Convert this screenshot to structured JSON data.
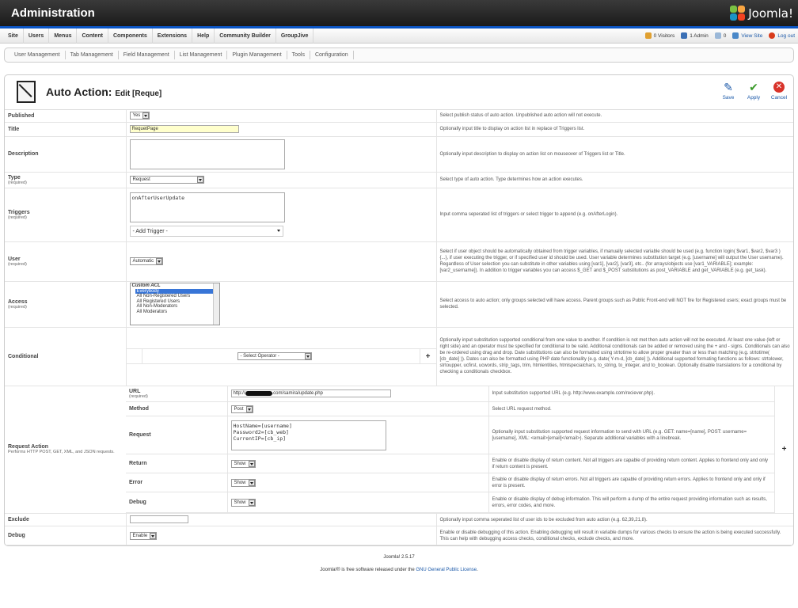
{
  "header": {
    "title": "Administration",
    "logo_text": "Joomla!"
  },
  "menubar": {
    "items": [
      "Site",
      "Users",
      "Menus",
      "Content",
      "Components",
      "Extensions",
      "Help",
      "Community Builder",
      "GroupJive"
    ],
    "visitors": "0 Visitors",
    "admins": "1 Admin",
    "messages": "0",
    "view_site": "View Site",
    "logout": "Log out"
  },
  "submenu": [
    "User Management",
    "Tab Management",
    "Field Management",
    "List Management",
    "Plugin Management",
    "Tools",
    "Configuration"
  ],
  "toolbar": {
    "title": "Auto Action:",
    "subtitle": "Edit [Reque]",
    "save": "Save",
    "apply": "Apply",
    "cancel": "Cancel"
  },
  "form": {
    "published": {
      "label": "Published",
      "value": "Yes",
      "desc": "Select publish status of auto action. Unpublished auto action will not execute."
    },
    "title": {
      "label": "Title",
      "value": "RequetPage",
      "desc": "Optionally input title to display on action list in replace of Triggers list."
    },
    "description": {
      "label": "Description",
      "value": "",
      "desc": "Optionally input description to display on action list on mouseover of Triggers list or Title."
    },
    "type": {
      "label": "Type",
      "required": "(required)",
      "value": "Request",
      "desc": "Select type of auto action. Type determines how an action executes."
    },
    "triggers": {
      "label": "Triggers",
      "required": "(required)",
      "value": "onAfterUserUpdate",
      "select": "- Add Trigger -",
      "desc": "Input comma seperated list of triggers or select trigger to append (e.g. onAfterLogin)."
    },
    "user": {
      "label": "User",
      "required": "(required)",
      "value": "Automatic",
      "desc": "Select if user object should be automatically obtained from trigger variables, if manually selected variable should be used (e.g. function login( $var1, $var2, $var3 ) {...}, if user executing the trigger, or if specified user id should be used. User variable determines substitution target (e.g. [username] will output the User username). Regardless of User selection you can substitute in other variables using [var1], [var2], [var3], etc.. (for arrays/objects use [var1_VARIABLE]; example: [var2_username]). In addition to trigger variables you can access $_GET and $_POST substitutions as post_VARIABLE and get_VARIABLE (e.g. get_task)."
    },
    "access": {
      "label": "Access",
      "required": "(required)",
      "options": [
        {
          "text": "Custom ACL",
          "kind": "group"
        },
        {
          "text": "Everybody",
          "kind": "selected"
        },
        {
          "text": "All Non-Registered Users",
          "kind": "indent"
        },
        {
          "text": "All Registered Users",
          "kind": "indent"
        },
        {
          "text": "All Non-Moderators",
          "kind": "indent"
        },
        {
          "text": "All Moderators",
          "kind": "indent"
        }
      ],
      "desc": "Select access to auto action; only groups selected will have access. Parent groups such as Public Front-end will NOT fire for Registered users; exact groups must be selected."
    },
    "conditional": {
      "label": "Conditional",
      "operator": "- Select Operator -",
      "add": "+",
      "desc": "Optionally input substitution supported conditional from one value to another. If condition is not met then auto action will not be executed. At least one value (left or right side) and an operator must be specified for conditional to be valid. Additional conditionals can be added or removed using the + and - signs. Conditionals can also be re-ordered using drag and drop. Date substitutions can also be formatted using strtotime to allow proper greater than or less than matching (e.g. strtotime( [cb_date] )). Dates can also be formatted using PHP date functionality (e.g. date( Y-m-d, [cb_date] )). Additional supported formating functions as follows: strtolower, strtoupper, ucfirst, ucwords, strip_tags, trim, htmlentities, htmlspecialchars, to_string, to_integer, and to_boolean. Optionally disable translations for a conditional by checking a conditionals checkbox."
    },
    "request_action": {
      "label": "Request Action",
      "sub": "Performs HTTP POST, GET, XML, and JSON requests.",
      "add": "+",
      "url": {
        "label": "URL",
        "required": "(required)",
        "value_pre": "http://",
        "value_post": ".com/samira/update.php",
        "desc": "Input substitution supported URL (e.g. http://www.example.com/reciever.php)."
      },
      "method": {
        "label": "Method",
        "value": "Post",
        "desc": "Select URL request method."
      },
      "request": {
        "label": "Request",
        "lines": [
          "HostName=[username]",
          "Password2=[cb_web]",
          "CurrentIP=[cb_ip]"
        ],
        "desc": "Optionally input substitution supported request information to send with URL (e.g. GET: name=[name], POST: username=[username], XML: <email>[email]</email>). Separate additional variables with a linebreak."
      },
      "return": {
        "label": "Return",
        "value": "Show",
        "desc": "Enable or disable display of return content. Not all triggers are capable of providing return content. Applies to frontend only and only if return content is present."
      },
      "error": {
        "label": "Error",
        "value": "Show",
        "desc": "Enable or disable display of return errors. Not all triggers are capable of providing return errors. Applies to frontend only and only if error is present."
      },
      "debug": {
        "label": "Debug",
        "value": "Show",
        "desc": "Enable or disable display of debug information. This will perform a dump of the entire request providing information such as results, errors, error codes, and more."
      }
    },
    "exclude": {
      "label": "Exclude",
      "value": "",
      "desc": "Optionally input comma seperated list of user ids to be excluded from auto action (e.g. 62,39,21,8)."
    },
    "debug": {
      "label": "Debug",
      "value": "Enable",
      "desc": "Enable or disable debugging of this action. Enabling debugging will result in variable dumps for various checks to ensure the action is being executed successfully. This can help with debugging access checks, conditional checks, exclude checks, and more."
    }
  },
  "footer": {
    "version": "Joomla! 2.5.17",
    "license_pre": "Joomla!® is free software released under the ",
    "license_link": "GNU General Public License",
    "license_post": "."
  },
  "colors": {
    "accent": "#0b55c4",
    "link": "#1a58a8",
    "header_bg": "#2a2a2a"
  }
}
